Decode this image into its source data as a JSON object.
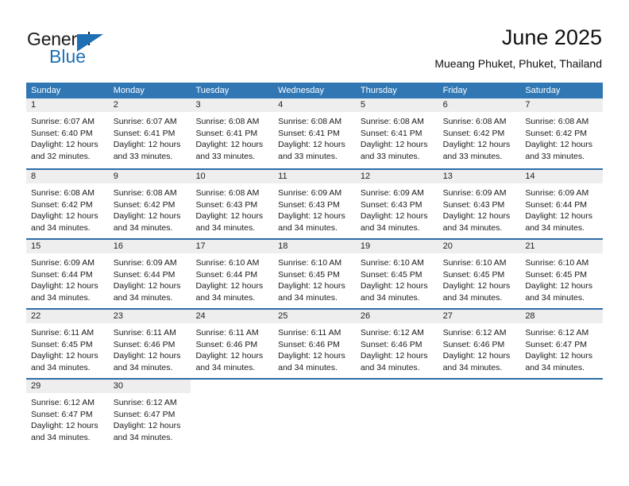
{
  "brand": {
    "name_part1": "General",
    "name_part2": "Blue",
    "triangle_color": "#1f6fb5"
  },
  "header": {
    "title": "June 2025",
    "subtitle": "Mueang Phuket, Phuket, Thailand"
  },
  "colors": {
    "header_bar": "#3077b4",
    "row_divider": "#2d6ca8",
    "day_band": "#eeeeee",
    "text": "#1a1a1a"
  },
  "weekdays": [
    "Sunday",
    "Monday",
    "Tuesday",
    "Wednesday",
    "Thursday",
    "Friday",
    "Saturday"
  ],
  "weeks": [
    [
      {
        "day": "1",
        "sunrise": "Sunrise: 6:07 AM",
        "sunset": "Sunset: 6:40 PM",
        "daylight_line1": "Daylight: 12 hours",
        "daylight_line2": "and 32 minutes."
      },
      {
        "day": "2",
        "sunrise": "Sunrise: 6:07 AM",
        "sunset": "Sunset: 6:41 PM",
        "daylight_line1": "Daylight: 12 hours",
        "daylight_line2": "and 33 minutes."
      },
      {
        "day": "3",
        "sunrise": "Sunrise: 6:08 AM",
        "sunset": "Sunset: 6:41 PM",
        "daylight_line1": "Daylight: 12 hours",
        "daylight_line2": "and 33 minutes."
      },
      {
        "day": "4",
        "sunrise": "Sunrise: 6:08 AM",
        "sunset": "Sunset: 6:41 PM",
        "daylight_line1": "Daylight: 12 hours",
        "daylight_line2": "and 33 minutes."
      },
      {
        "day": "5",
        "sunrise": "Sunrise: 6:08 AM",
        "sunset": "Sunset: 6:41 PM",
        "daylight_line1": "Daylight: 12 hours",
        "daylight_line2": "and 33 minutes."
      },
      {
        "day": "6",
        "sunrise": "Sunrise: 6:08 AM",
        "sunset": "Sunset: 6:42 PM",
        "daylight_line1": "Daylight: 12 hours",
        "daylight_line2": "and 33 minutes."
      },
      {
        "day": "7",
        "sunrise": "Sunrise: 6:08 AM",
        "sunset": "Sunset: 6:42 PM",
        "daylight_line1": "Daylight: 12 hours",
        "daylight_line2": "and 33 minutes."
      }
    ],
    [
      {
        "day": "8",
        "sunrise": "Sunrise: 6:08 AM",
        "sunset": "Sunset: 6:42 PM",
        "daylight_line1": "Daylight: 12 hours",
        "daylight_line2": "and 34 minutes."
      },
      {
        "day": "9",
        "sunrise": "Sunrise: 6:08 AM",
        "sunset": "Sunset: 6:42 PM",
        "daylight_line1": "Daylight: 12 hours",
        "daylight_line2": "and 34 minutes."
      },
      {
        "day": "10",
        "sunrise": "Sunrise: 6:08 AM",
        "sunset": "Sunset: 6:43 PM",
        "daylight_line1": "Daylight: 12 hours",
        "daylight_line2": "and 34 minutes."
      },
      {
        "day": "11",
        "sunrise": "Sunrise: 6:09 AM",
        "sunset": "Sunset: 6:43 PM",
        "daylight_line1": "Daylight: 12 hours",
        "daylight_line2": "and 34 minutes."
      },
      {
        "day": "12",
        "sunrise": "Sunrise: 6:09 AM",
        "sunset": "Sunset: 6:43 PM",
        "daylight_line1": "Daylight: 12 hours",
        "daylight_line2": "and 34 minutes."
      },
      {
        "day": "13",
        "sunrise": "Sunrise: 6:09 AM",
        "sunset": "Sunset: 6:43 PM",
        "daylight_line1": "Daylight: 12 hours",
        "daylight_line2": "and 34 minutes."
      },
      {
        "day": "14",
        "sunrise": "Sunrise: 6:09 AM",
        "sunset": "Sunset: 6:44 PM",
        "daylight_line1": "Daylight: 12 hours",
        "daylight_line2": "and 34 minutes."
      }
    ],
    [
      {
        "day": "15",
        "sunrise": "Sunrise: 6:09 AM",
        "sunset": "Sunset: 6:44 PM",
        "daylight_line1": "Daylight: 12 hours",
        "daylight_line2": "and 34 minutes."
      },
      {
        "day": "16",
        "sunrise": "Sunrise: 6:09 AM",
        "sunset": "Sunset: 6:44 PM",
        "daylight_line1": "Daylight: 12 hours",
        "daylight_line2": "and 34 minutes."
      },
      {
        "day": "17",
        "sunrise": "Sunrise: 6:10 AM",
        "sunset": "Sunset: 6:44 PM",
        "daylight_line1": "Daylight: 12 hours",
        "daylight_line2": "and 34 minutes."
      },
      {
        "day": "18",
        "sunrise": "Sunrise: 6:10 AM",
        "sunset": "Sunset: 6:45 PM",
        "daylight_line1": "Daylight: 12 hours",
        "daylight_line2": "and 34 minutes."
      },
      {
        "day": "19",
        "sunrise": "Sunrise: 6:10 AM",
        "sunset": "Sunset: 6:45 PM",
        "daylight_line1": "Daylight: 12 hours",
        "daylight_line2": "and 34 minutes."
      },
      {
        "day": "20",
        "sunrise": "Sunrise: 6:10 AM",
        "sunset": "Sunset: 6:45 PM",
        "daylight_line1": "Daylight: 12 hours",
        "daylight_line2": "and 34 minutes."
      },
      {
        "day": "21",
        "sunrise": "Sunrise: 6:10 AM",
        "sunset": "Sunset: 6:45 PM",
        "daylight_line1": "Daylight: 12 hours",
        "daylight_line2": "and 34 minutes."
      }
    ],
    [
      {
        "day": "22",
        "sunrise": "Sunrise: 6:11 AM",
        "sunset": "Sunset: 6:45 PM",
        "daylight_line1": "Daylight: 12 hours",
        "daylight_line2": "and 34 minutes."
      },
      {
        "day": "23",
        "sunrise": "Sunrise: 6:11 AM",
        "sunset": "Sunset: 6:46 PM",
        "daylight_line1": "Daylight: 12 hours",
        "daylight_line2": "and 34 minutes."
      },
      {
        "day": "24",
        "sunrise": "Sunrise: 6:11 AM",
        "sunset": "Sunset: 6:46 PM",
        "daylight_line1": "Daylight: 12 hours",
        "daylight_line2": "and 34 minutes."
      },
      {
        "day": "25",
        "sunrise": "Sunrise: 6:11 AM",
        "sunset": "Sunset: 6:46 PM",
        "daylight_line1": "Daylight: 12 hours",
        "daylight_line2": "and 34 minutes."
      },
      {
        "day": "26",
        "sunrise": "Sunrise: 6:12 AM",
        "sunset": "Sunset: 6:46 PM",
        "daylight_line1": "Daylight: 12 hours",
        "daylight_line2": "and 34 minutes."
      },
      {
        "day": "27",
        "sunrise": "Sunrise: 6:12 AM",
        "sunset": "Sunset: 6:46 PM",
        "daylight_line1": "Daylight: 12 hours",
        "daylight_line2": "and 34 minutes."
      },
      {
        "day": "28",
        "sunrise": "Sunrise: 6:12 AM",
        "sunset": "Sunset: 6:47 PM",
        "daylight_line1": "Daylight: 12 hours",
        "daylight_line2": "and 34 minutes."
      }
    ],
    [
      {
        "day": "29",
        "sunrise": "Sunrise: 6:12 AM",
        "sunset": "Sunset: 6:47 PM",
        "daylight_line1": "Daylight: 12 hours",
        "daylight_line2": "and 34 minutes."
      },
      {
        "day": "30",
        "sunrise": "Sunrise: 6:12 AM",
        "sunset": "Sunset: 6:47 PM",
        "daylight_line1": "Daylight: 12 hours",
        "daylight_line2": "and 34 minutes."
      },
      {
        "day": "",
        "sunrise": "",
        "sunset": "",
        "daylight_line1": "",
        "daylight_line2": ""
      },
      {
        "day": "",
        "sunrise": "",
        "sunset": "",
        "daylight_line1": "",
        "daylight_line2": ""
      },
      {
        "day": "",
        "sunrise": "",
        "sunset": "",
        "daylight_line1": "",
        "daylight_line2": ""
      },
      {
        "day": "",
        "sunrise": "",
        "sunset": "",
        "daylight_line1": "",
        "daylight_line2": ""
      },
      {
        "day": "",
        "sunrise": "",
        "sunset": "",
        "daylight_line1": "",
        "daylight_line2": ""
      }
    ]
  ]
}
